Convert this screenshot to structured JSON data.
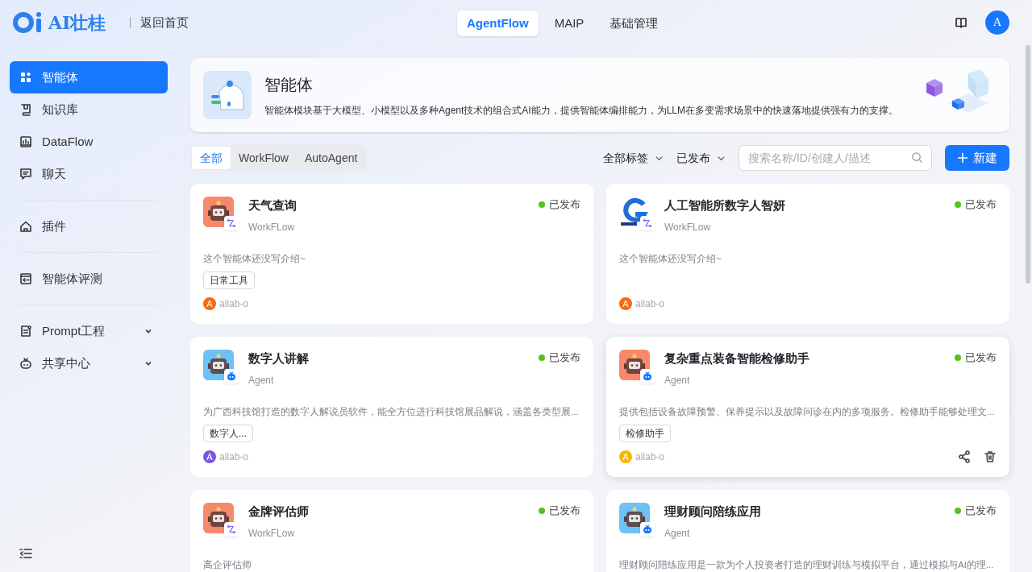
{
  "header": {
    "logo_text": "AI壮桂",
    "back_link": "返回首页",
    "nav_tabs": [
      {
        "label": "AgentFlow",
        "selected": true
      },
      {
        "label": "MAIP",
        "selected": false
      },
      {
        "label": "基础管理",
        "selected": false
      }
    ],
    "user_avatar": "A"
  },
  "sidebar": {
    "groups": [
      [
        {
          "label": "智能体",
          "selected": true
        },
        {
          "label": "知识库",
          "selected": false
        },
        {
          "label": "DataFlow",
          "selected": false
        },
        {
          "label": "聊天",
          "selected": false
        }
      ],
      [
        {
          "label": "插件",
          "selected": false
        }
      ],
      [
        {
          "label": "智能体评测",
          "selected": false
        }
      ],
      [
        {
          "label": "Prompt工程",
          "selected": false,
          "expanded": false
        },
        {
          "label": "共享中心",
          "selected": false,
          "expanded": false
        }
      ]
    ]
  },
  "banner": {
    "title": "智能体",
    "description": "智能体模块基于大模型、小模型以及多种Agent技术的组合式AI能力，提供智能体编排能力，为LLM在多变需求场景中的快速落地提供强有力的支撑。"
  },
  "filter_tabs": [
    {
      "label": "全部",
      "selected": true
    },
    {
      "label": "WorkFlow",
      "selected": false
    },
    {
      "label": "AutoAgent",
      "selected": false
    }
  ],
  "dropdowns": [
    "全部标签",
    "已发布"
  ],
  "search": {
    "placeholder": "搜索名称/ID/创建人/描述"
  },
  "new_button": "新建",
  "cards": [
    {
      "title": "天气查询",
      "type": "WorkFLow",
      "kind": "workflow",
      "avatar": {
        "kind": "robot",
        "color": "#f7896b"
      },
      "status": "已发布",
      "description": "这个智能体还没写介绍~",
      "tags": [
        "日常工具"
      ],
      "author": {
        "name": "ailab-o",
        "initial": "A",
        "color": "#f56c0b"
      },
      "hovered": false
    },
    {
      "title": "人工智能所数字人智妍",
      "type": "WorkFLow",
      "kind": "workflow",
      "avatar": {
        "kind": "logo",
        "color": "#1f6fd6"
      },
      "status": "已发布",
      "description": "这个智能体还没写介绍~",
      "author": {
        "name": "ailab-o",
        "initial": "A",
        "color": "#f56c0b"
      },
      "hovered": false
    },
    {
      "title": "数字人讲解",
      "type": "Agent",
      "kind": "agent",
      "avatar": {
        "kind": "robot",
        "color": "#6cc1f7"
      },
      "status": "已发布",
      "description": "为广西科技馆打造的数字人解说员软件，能全方位进行科技馆展品解说，涵盖各类型展...",
      "tags": [
        "数字人..."
      ],
      "author": {
        "name": "ailab-o",
        "initial": "A",
        "color": "#7a5ae0"
      },
      "hovered": false
    },
    {
      "title": "复杂重点装备智能检修助手",
      "type": "Agent",
      "kind": "agent",
      "avatar": {
        "kind": "robot",
        "color": "#f7896b"
      },
      "status": "已发布",
      "description": "提供包括设备故障预警、保养提示以及故障问诊在内的多项服务。检修助手能够处理文...",
      "tags": [
        "检修助手"
      ],
      "author": {
        "name": "ailab-o",
        "initial": "A",
        "color": "#f5b800"
      },
      "hovered": true
    },
    {
      "title": "金牌评估师",
      "type": "WorkFLow",
      "kind": "workflow",
      "avatar": {
        "kind": "robot",
        "color": "#f7896b"
      },
      "status": "已发布",
      "description": "高企评估师",
      "hovered": false
    },
    {
      "title": "理财顾问陪练应用",
      "type": "Agent",
      "kind": "agent",
      "avatar": {
        "kind": "robot",
        "color": "#6cc1f7"
      },
      "status": "已发布",
      "description": "理财顾问陪练应用是一款为个人投资者打造的理财训练与模拟平台，通过模拟与AI的理...",
      "hovered": false
    }
  ]
}
